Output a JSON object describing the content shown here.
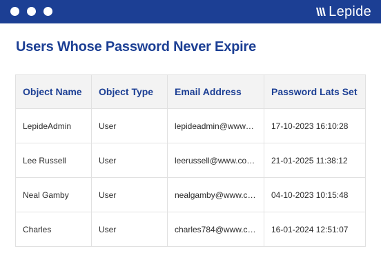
{
  "window": {
    "brand_name": "Lepide",
    "brand_icon": "lepide-logo-icon",
    "header_color": "#1c3f94"
  },
  "report": {
    "title": "Users Whose Password Never Expire",
    "columns": [
      "Object Name",
      "Object Type",
      "Email Address",
      "Password Lats Set"
    ],
    "rows": [
      [
        "LepideAdmin",
        "User",
        "lepideadmin@www…",
        "17-10-2023 16:10:28"
      ],
      [
        "Lee Russell",
        "User",
        "leerussell@www.cod…",
        "21-01-2025 11:38:12"
      ],
      [
        "Neal Gamby",
        "User",
        "nealgamby@www.co…",
        "04-10-2023 10:15:48"
      ],
      [
        "Charles",
        "User",
        "charles784@www.co…",
        "16-01-2024 12:51:07"
      ]
    ]
  }
}
